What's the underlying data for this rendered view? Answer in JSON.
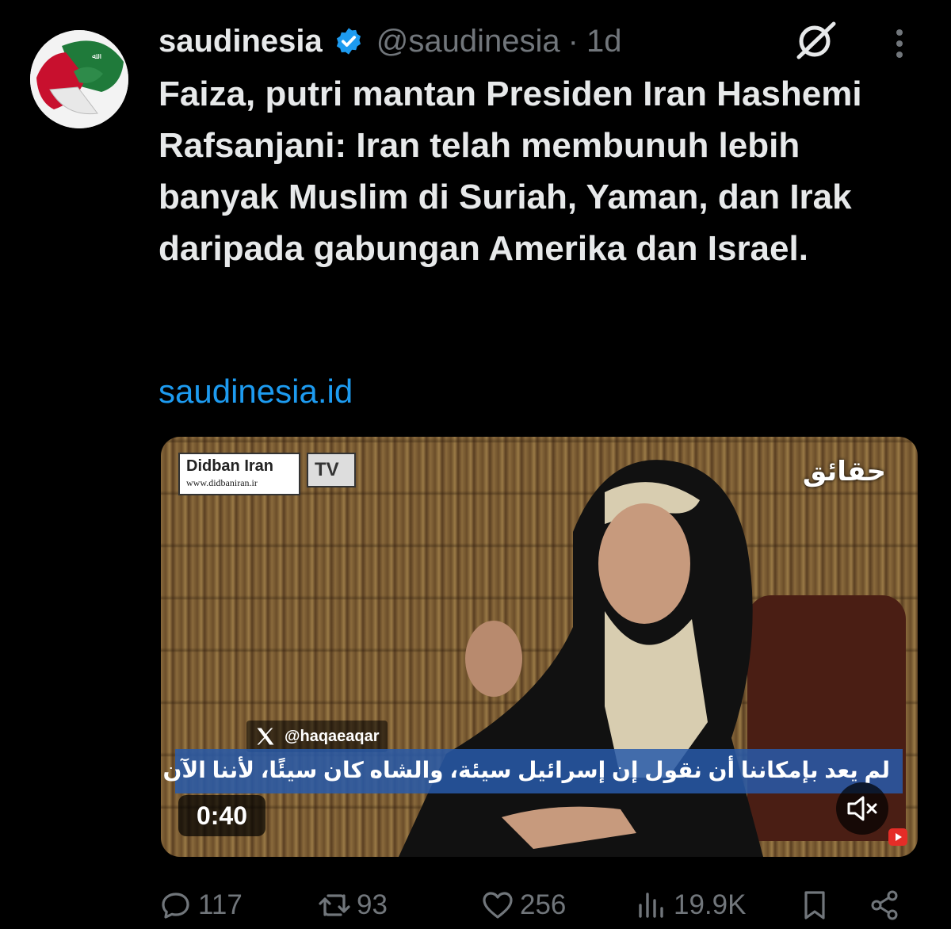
{
  "post": {
    "display_name": "saudinesia",
    "verified_icon": "verified-badge-icon",
    "handle": "@saudinesia",
    "separator": "·",
    "time": "1d",
    "text": "Faiza, putri mantan Presiden Iran Hashemi Rafsanjani: Iran telah membunuh lebih banyak Muslim di Suriah, Yaman, dan Irak daripada gabungan Amerika dan Israel.",
    "link": "saudinesia.id"
  },
  "media": {
    "logo_title": "Didban Iran",
    "logo_url": "www.didbaniran.ir",
    "tv_label": "TV",
    "channel_label": "حقائق",
    "watermark_handle": "@haqaeaqar",
    "subtitle": "لم يعد بإمكاننا أن نقول إن إسرائيل سيئة، والشاه كان سيئًا، لأننا الآن أسوأ منهم جميعًا",
    "duration": "0:40"
  },
  "actions": {
    "replies": "117",
    "reposts": "93",
    "likes": "256",
    "views": "19.9K"
  },
  "colors": {
    "background": "#000000",
    "text": "#e7e9ea",
    "muted": "#71767b",
    "link": "#1d9bf0",
    "verified": "#1d9bf0"
  }
}
